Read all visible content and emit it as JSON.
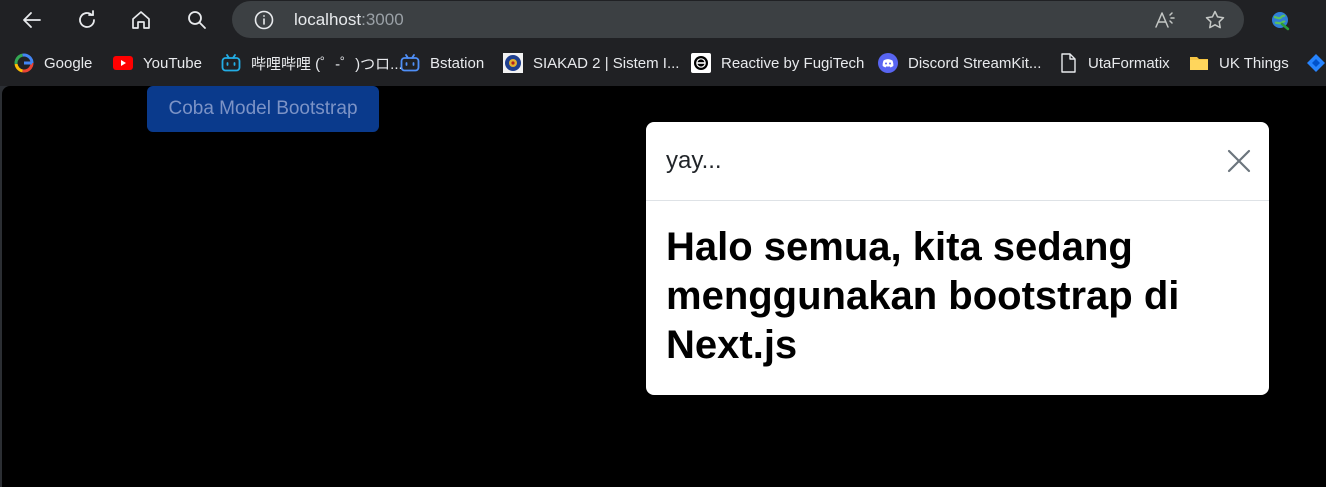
{
  "browser": {
    "address_url_host": "localhost",
    "address_url_port": ":3000"
  },
  "bookmarks": [
    {
      "label": "Google",
      "icon": "google-icon"
    },
    {
      "label": "YouTube",
      "icon": "youtube-icon"
    },
    {
      "label": "哔哩哔哩 (゜-゜)つロ...",
      "icon": "bilibili-icon"
    },
    {
      "label": "Bstation",
      "icon": "bilibili-icon"
    },
    {
      "label": "SIAKAD 2 | Sistem I...",
      "icon": "siakad-icon"
    },
    {
      "label": "Reactive by FugiTech",
      "icon": "reactive-icon"
    },
    {
      "label": "Discord StreamKit...",
      "icon": "discord-icon"
    },
    {
      "label": "UtaFormatix",
      "icon": "file-icon"
    },
    {
      "label": "UK Things",
      "icon": "folder-icon"
    }
  ],
  "page": {
    "trigger_button_label": "Coba Model Bootstrap",
    "modal_title": "yay...",
    "modal_body_heading": "Halo semua, kita sedang menggunakan bootstrap di Next.js"
  },
  "colors": {
    "browser_chrome": "#202124",
    "address_bar": "#3c4043",
    "page_background": "#000000",
    "button_primary": "#0a3a8c",
    "modal_background": "#ffffff"
  }
}
